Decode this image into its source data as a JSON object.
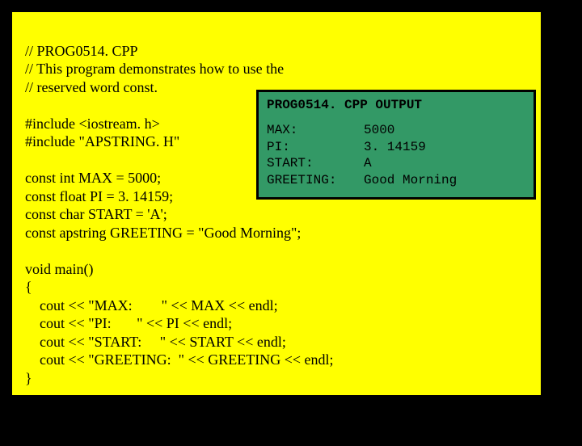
{
  "code": {
    "line1": "// PROG0514. CPP",
    "line2": "// This program demonstrates how to use the",
    "line3": "// reserved word const.",
    "line4": "",
    "line5": "#include <iostream. h>",
    "line6": "#include \"APSTRING. H\"",
    "line7": "",
    "line8": "const int MAX = 5000;",
    "line9": "const float PI = 3. 14159;",
    "line10": "const char START = 'A';",
    "line11": "const apstring GREETING = \"Good Morning\";",
    "line12": "",
    "line13": "void main()",
    "line14": "{",
    "line15": "    cout << \"MAX:        \" << MAX << endl;",
    "line16": "    cout << \"PI:       \" << PI << endl;",
    "line17": "    cout << \"START:     \" << START << endl;",
    "line18": "    cout << \"GREETING:  \" << GREETING << endl;",
    "line19": "}"
  },
  "output": {
    "title": "PROG0514. CPP  OUTPUT",
    "rows": [
      {
        "label": "MAX:",
        "value": "5000"
      },
      {
        "label": "PI:",
        "value": "3. 14159"
      },
      {
        "label": "START:",
        "value": "A"
      },
      {
        "label": "GREETING:",
        "value": "Good Morning"
      }
    ]
  }
}
